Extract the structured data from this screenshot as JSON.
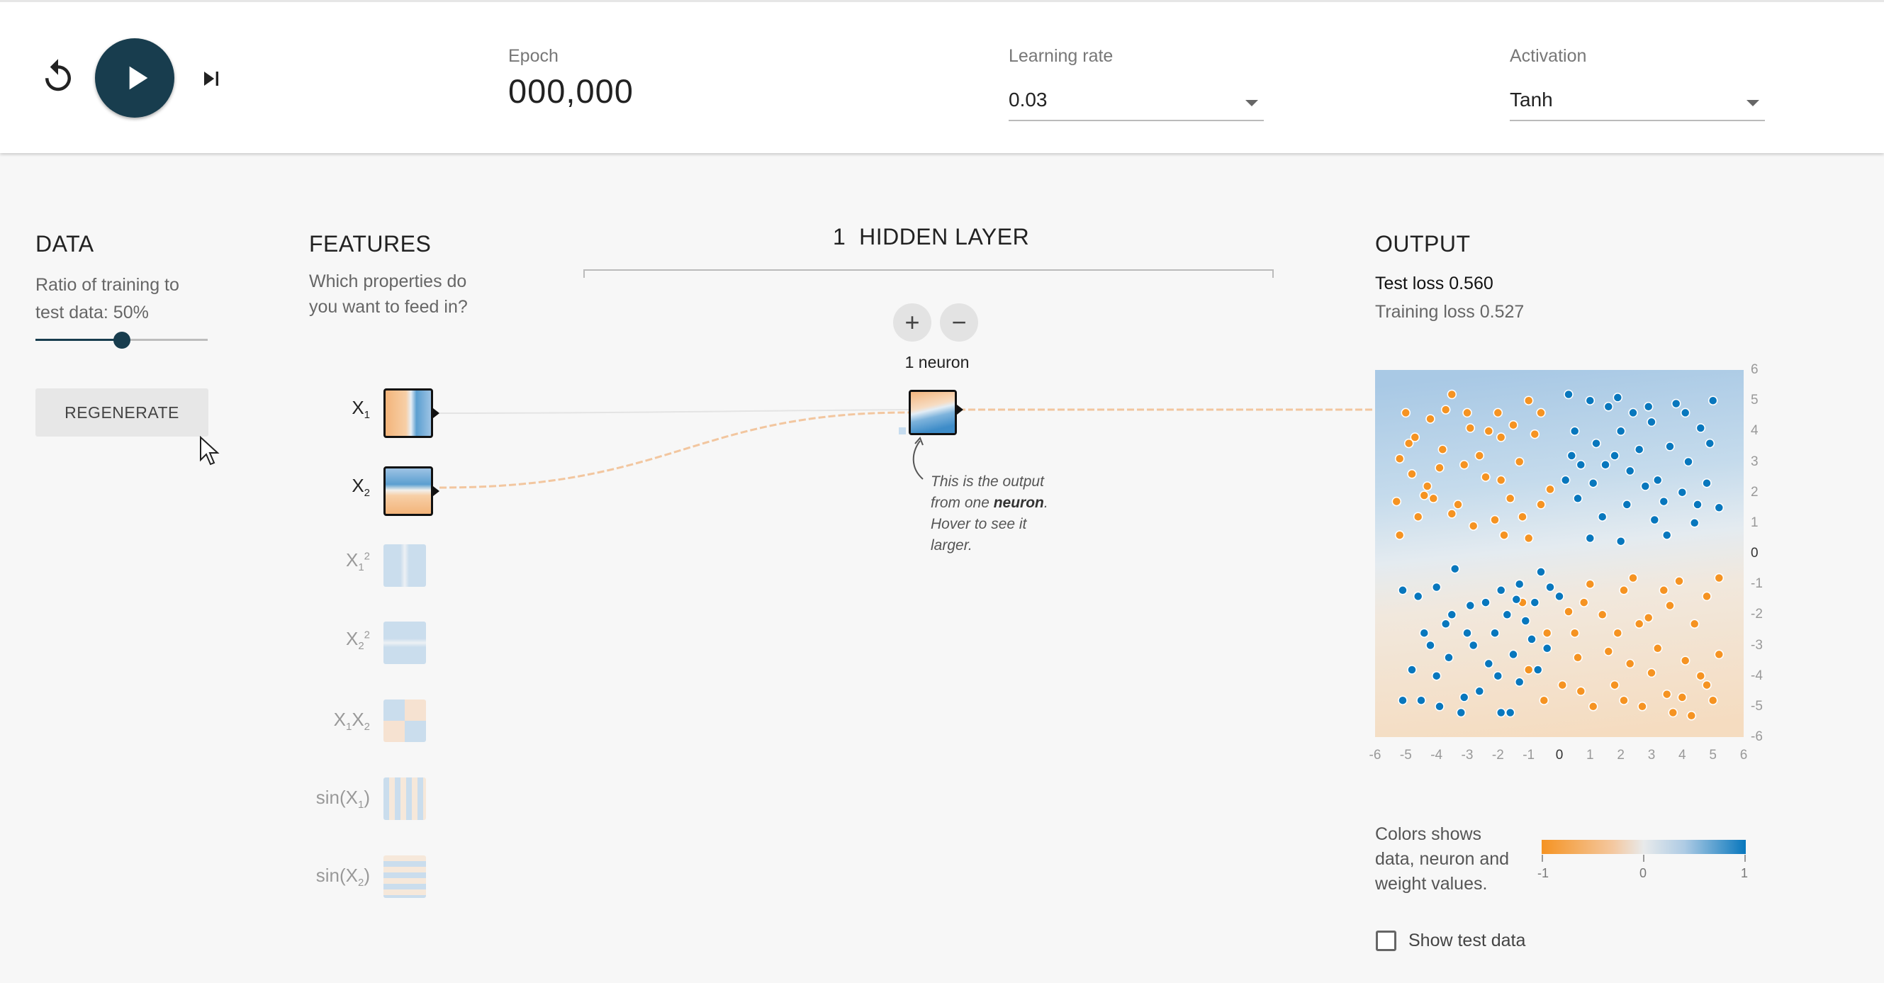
{
  "controls": {
    "reset_icon": "reset-icon",
    "play_icon": "play-icon",
    "step_icon": "step-icon"
  },
  "epoch": {
    "label": "Epoch",
    "value": "000,000"
  },
  "learning_rate": {
    "label": "Learning rate",
    "value": "0.03"
  },
  "activation": {
    "label": "Activation",
    "value": "Tanh"
  },
  "data_panel": {
    "title": "DATA",
    "ratio_line1": "Ratio of training to",
    "ratio_line2": "test data:  50%",
    "ratio_value": 0.5,
    "regenerate_label": "REGENERATE"
  },
  "features_panel": {
    "title": "FEATURES",
    "subtitle_line1": "Which properties do",
    "subtitle_line2": "you want to feed in?",
    "features": [
      {
        "base": "X",
        "sub": "1",
        "sup": "",
        "active": true
      },
      {
        "base": "X",
        "sub": "2",
        "sup": "",
        "active": true
      },
      {
        "base": "X",
        "sub": "1",
        "sup": "2",
        "active": false
      },
      {
        "base": "X",
        "sub": "2",
        "sup": "2",
        "active": false
      },
      {
        "base": "X",
        "sub": "1",
        "base2": "X",
        "sub2": "2",
        "active": false
      },
      {
        "base": "sin(X",
        "sub": "1",
        "tail": ")",
        "active": false
      },
      {
        "base": "sin(X",
        "sub": "2",
        "tail": ")",
        "active": false
      }
    ]
  },
  "hidden": {
    "count": "1",
    "title": "HIDDEN LAYER",
    "add_label": "+",
    "remove_label": "−",
    "neurons_label": "1 neuron",
    "note_line1": "This is the output",
    "note_line2_pre": "from one ",
    "note_line2_bold": "neuron",
    "note_line2_post": ".",
    "note_line3": "Hover to see it",
    "note_line4": "larger."
  },
  "output": {
    "title": "OUTPUT",
    "test_loss": "Test loss 0.560",
    "training_loss": "Training loss 0.527",
    "y_ticks": [
      "6",
      "5",
      "4",
      "3",
      "2",
      "1",
      "0",
      "-1",
      "-2",
      "-3",
      "-4",
      "-5",
      "-6"
    ],
    "x_ticks": [
      "-6",
      "-5",
      "-4",
      "-3",
      "-2",
      "-1",
      "0",
      "1",
      "2",
      "3",
      "4",
      "5",
      "6"
    ],
    "legend_line1": "Colors shows",
    "legend_line2": "data, neuron and",
    "legend_line3": "weight values.",
    "colorbar_ticks": [
      "-1",
      "0",
      "1"
    ],
    "show_test_label": "Show test data",
    "show_test_checked": false
  },
  "colors": {
    "orange": "#f59322",
    "blue": "#0877bd",
    "dark": "#183d4e"
  },
  "chart_data": {
    "type": "scatter",
    "title": "",
    "xlabel": "",
    "ylabel": "",
    "xlim": [
      -6,
      6
    ],
    "ylim": [
      -6,
      6
    ],
    "series": [
      {
        "values": [
          [
            -5.0,
            4.6
          ],
          [
            -4.7,
            3.8
          ],
          [
            -4.2,
            4.4
          ],
          [
            -3.5,
            5.2
          ],
          [
            -3.0,
            4.6
          ],
          [
            -2.3,
            4.0
          ],
          [
            -1.9,
            3.8
          ],
          [
            -1.5,
            4.2
          ],
          [
            -1.0,
            5.0
          ],
          [
            -0.6,
            4.6
          ],
          [
            -5.2,
            3.1
          ],
          [
            -4.8,
            2.6
          ],
          [
            -4.3,
            2.2
          ],
          [
            -3.8,
            3.4
          ],
          [
            -3.1,
            2.9
          ],
          [
            -2.6,
            3.2
          ],
          [
            -1.9,
            2.4
          ],
          [
            -1.3,
            3.0
          ],
          [
            -5.3,
            1.7
          ],
          [
            -4.6,
            1.2
          ],
          [
            -3.5,
            1.3
          ],
          [
            -2.8,
            0.9
          ],
          [
            -1.2,
            1.2
          ],
          [
            -1.0,
            0.5
          ],
          [
            -5.2,
            0.6
          ],
          [
            -4.1,
            1.8
          ],
          [
            -3.3,
            1.6
          ],
          [
            -2.1,
            1.1
          ],
          [
            -1.8,
            0.6
          ],
          [
            -0.6,
            1.6
          ],
          [
            0.8,
            -1.6
          ],
          [
            1.4,
            -2.0
          ],
          [
            2.1,
            -1.2
          ],
          [
            2.6,
            -2.3
          ],
          [
            3.4,
            -1.2
          ],
          [
            3.9,
            -0.9
          ],
          [
            4.8,
            -1.4
          ],
          [
            5.2,
            -0.8
          ],
          [
            0.5,
            -2.6
          ],
          [
            1.6,
            -3.2
          ],
          [
            2.3,
            -3.6
          ],
          [
            3.2,
            -3.1
          ],
          [
            4.1,
            -3.5
          ],
          [
            4.8,
            -4.3
          ],
          [
            5.0,
            -4.8
          ],
          [
            0.7,
            -4.5
          ],
          [
            1.8,
            -4.3
          ],
          [
            2.7,
            -5.0
          ],
          [
            3.5,
            -4.6
          ],
          [
            4.3,
            -5.3
          ],
          [
            -1.0,
            -3.8
          ],
          [
            -0.5,
            -4.8
          ],
          [
            0.1,
            -4.3
          ],
          [
            1.1,
            -5.0
          ],
          [
            2.1,
            -4.8
          ],
          [
            3.7,
            -5.2
          ],
          [
            4.6,
            -4.0
          ],
          [
            -1.2,
            -1.6
          ],
          [
            -0.4,
            -2.6
          ],
          [
            0.6,
            -3.4
          ],
          [
            2.9,
            -2.1
          ],
          [
            3.6,
            -1.7
          ],
          [
            4.4,
            -2.3
          ],
          [
            1.0,
            -1.0
          ],
          [
            2.4,
            -0.8
          ],
          [
            3.0,
            -3.9
          ],
          [
            5.2,
            -3.3
          ],
          [
            4.0,
            -4.7
          ],
          [
            1.9,
            -2.6
          ],
          [
            0.3,
            -1.9
          ],
          [
            -4.4,
            1.9
          ],
          [
            -3.9,
            2.8
          ],
          [
            -2.4,
            2.5
          ],
          [
            -1.6,
            1.8
          ],
          [
            -0.3,
            2.1
          ],
          [
            -2.9,
            4.1
          ],
          [
            -4.9,
            3.6
          ],
          [
            -2.0,
            4.6
          ],
          [
            -3.7,
            4.7
          ],
          [
            -0.8,
            3.9
          ]
        ]
      },
      {
        "values": [
          [
            0.3,
            5.2
          ],
          [
            1.0,
            5.0
          ],
          [
            1.6,
            4.8
          ],
          [
            2.4,
            4.6
          ],
          [
            3.8,
            4.9
          ],
          [
            4.6,
            4.1
          ],
          [
            5.0,
            5.0
          ],
          [
            0.5,
            4.0
          ],
          [
            1.2,
            3.6
          ],
          [
            2.0,
            4.0
          ],
          [
            3.0,
            4.3
          ],
          [
            4.2,
            3.0
          ],
          [
            4.9,
            3.6
          ],
          [
            0.4,
            3.2
          ],
          [
            1.5,
            2.9
          ],
          [
            2.3,
            2.7
          ],
          [
            3.2,
            2.4
          ],
          [
            4.0,
            2.0
          ],
          [
            4.8,
            2.3
          ],
          [
            0.6,
            1.8
          ],
          [
            1.4,
            1.2
          ],
          [
            2.2,
            1.6
          ],
          [
            3.1,
            1.1
          ],
          [
            4.4,
            1.0
          ],
          [
            5.2,
            1.5
          ],
          [
            1.0,
            0.5
          ],
          [
            2.0,
            0.4
          ],
          [
            3.5,
            0.6
          ],
          [
            0.2,
            2.4
          ],
          [
            2.6,
            3.4
          ],
          [
            -5.1,
            -1.2
          ],
          [
            -4.6,
            -1.4
          ],
          [
            -4.0,
            -1.1
          ],
          [
            -3.5,
            -2.0
          ],
          [
            -3.0,
            -2.6
          ],
          [
            -2.4,
            -1.6
          ],
          [
            -1.9,
            -1.2
          ],
          [
            -1.3,
            -1.0
          ],
          [
            -0.8,
            -1.6
          ],
          [
            -0.3,
            -1.1
          ],
          [
            -4.2,
            -3.0
          ],
          [
            -3.6,
            -3.4
          ],
          [
            -2.8,
            -3.0
          ],
          [
            -2.1,
            -2.6
          ],
          [
            -1.5,
            -3.3
          ],
          [
            -0.9,
            -2.8
          ],
          [
            -5.1,
            -4.8
          ],
          [
            -4.5,
            -4.8
          ],
          [
            -3.9,
            -5.0
          ],
          [
            -3.2,
            -5.2
          ],
          [
            -2.6,
            -4.5
          ],
          [
            -1.9,
            -5.2
          ],
          [
            -1.3,
            -4.2
          ],
          [
            -0.7,
            -3.8
          ],
          [
            -4.0,
            -4.0
          ],
          [
            -3.1,
            -4.7
          ],
          [
            -1.6,
            -5.2
          ],
          [
            -2.3,
            -3.6
          ],
          [
            -1.1,
            -2.2
          ],
          [
            -3.7,
            -2.3
          ],
          [
            -2.9,
            -1.7
          ],
          [
            -1.7,
            -2.0
          ],
          [
            -0.6,
            -0.6
          ],
          [
            -3.4,
            -0.5
          ],
          [
            -4.4,
            -2.6
          ],
          [
            -2.0,
            -4.0
          ],
          [
            -1.4,
            -1.5
          ],
          [
            0.0,
            -1.4
          ],
          [
            -4.8,
            -3.8
          ],
          [
            -0.4,
            -3.1
          ],
          [
            1.8,
            3.2
          ],
          [
            2.8,
            2.2
          ],
          [
            3.6,
            3.5
          ],
          [
            4.5,
            1.6
          ],
          [
            1.1,
            2.3
          ],
          [
            0.7,
            2.9
          ],
          [
            3.4,
            1.7
          ],
          [
            2.9,
            4.8
          ],
          [
            1.9,
            5.1
          ],
          [
            4.1,
            4.6
          ]
        ]
      }
    ]
  }
}
